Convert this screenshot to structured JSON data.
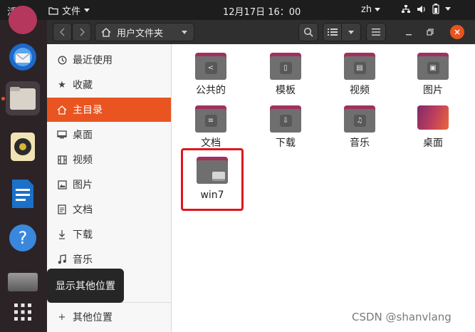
{
  "topbar": {
    "activities": "活动",
    "app_menu": "文件",
    "clock": "12月17日  16：00",
    "lang": "zh"
  },
  "header": {
    "path_label": "用户文件夹"
  },
  "sidebar": {
    "items": [
      {
        "label": "最近使用",
        "icon": "clock-icon"
      },
      {
        "label": "收藏",
        "icon": "star-icon"
      },
      {
        "label": "主目录",
        "icon": "home-icon"
      },
      {
        "label": "桌面",
        "icon": "desktop-icon"
      },
      {
        "label": "视频",
        "icon": "film-icon"
      },
      {
        "label": "图片",
        "icon": "picture-icon"
      },
      {
        "label": "文档",
        "icon": "document-icon"
      },
      {
        "label": "下载",
        "icon": "download-icon"
      },
      {
        "label": "音乐",
        "icon": "music-icon"
      }
    ],
    "other_locations": "其他位置"
  },
  "tooltip": "显示其他位置",
  "files": [
    {
      "name": "公共的",
      "icon": "share-icon"
    },
    {
      "name": "模板",
      "icon": "template-icon"
    },
    {
      "name": "视频",
      "icon": "film-icon"
    },
    {
      "name": "图片",
      "icon": "picture-icon"
    },
    {
      "name": "文档",
      "icon": "document-icon"
    },
    {
      "name": "下载",
      "icon": "download-icon"
    },
    {
      "name": "音乐",
      "icon": "music-icon"
    },
    {
      "name": "桌面",
      "icon": "desktop-icon"
    },
    {
      "name": "win7",
      "icon": "drive-icon"
    }
  ],
  "watermark": "CSDN @shanvlang",
  "colors": {
    "accent": "#e95420",
    "folder_tab": "#a1305e",
    "folder_body": "#6f6f6f",
    "highlight_box": "#e0141e"
  }
}
